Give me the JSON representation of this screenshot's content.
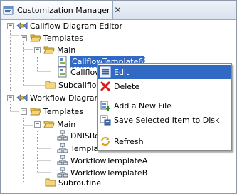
{
  "view": {
    "title": "Customization Manager",
    "close_glyph": "✕"
  },
  "tree": {
    "nodes": [
      {
        "label": "Callflow Diagram Editor",
        "icon": "editor-icon"
      },
      {
        "label": "Templates",
        "icon": "folder-open-icon"
      },
      {
        "label": "Main",
        "icon": "folder-open-icon"
      },
      {
        "label": "CallflowTemplate6",
        "icon": "template-icon",
        "selected": true
      },
      {
        "label": "CallflowTemplate",
        "icon": "template-icon"
      },
      {
        "label": "SubcallflowTemplate",
        "icon": "folder-closed-icon"
      },
      {
        "label": "Workflow Diagram Editor",
        "icon": "editor-icon"
      },
      {
        "label": "Templates",
        "icon": "folder-open-icon"
      },
      {
        "label": "Main",
        "icon": "folder-open-icon"
      },
      {
        "label": "DNISRouting",
        "icon": "workflow-icon"
      },
      {
        "label": "Template",
        "icon": "workflow-icon"
      },
      {
        "label": "WorkflowTemplateA",
        "icon": "workflow-icon"
      },
      {
        "label": "WorkflowTemplateB",
        "icon": "workflow-icon"
      },
      {
        "label": "Subroutine",
        "icon": "folder-closed-icon"
      }
    ],
    "toggle_minus": "−"
  },
  "context_menu": {
    "items": [
      {
        "label": "Edit",
        "icon": "edit-icon",
        "highlighted": true
      },
      {
        "label": "Delete",
        "icon": "delete-icon"
      },
      {
        "label": "Add a New File",
        "icon": "add-file-icon"
      },
      {
        "label": "Save Selected Item to Disk",
        "icon": "save-disk-icon"
      },
      {
        "label": "Refresh",
        "icon": "refresh-icon"
      }
    ]
  },
  "colors": {
    "selection": "#316ac5",
    "folder": "#f5d57a",
    "delete": "#d81e1e"
  }
}
